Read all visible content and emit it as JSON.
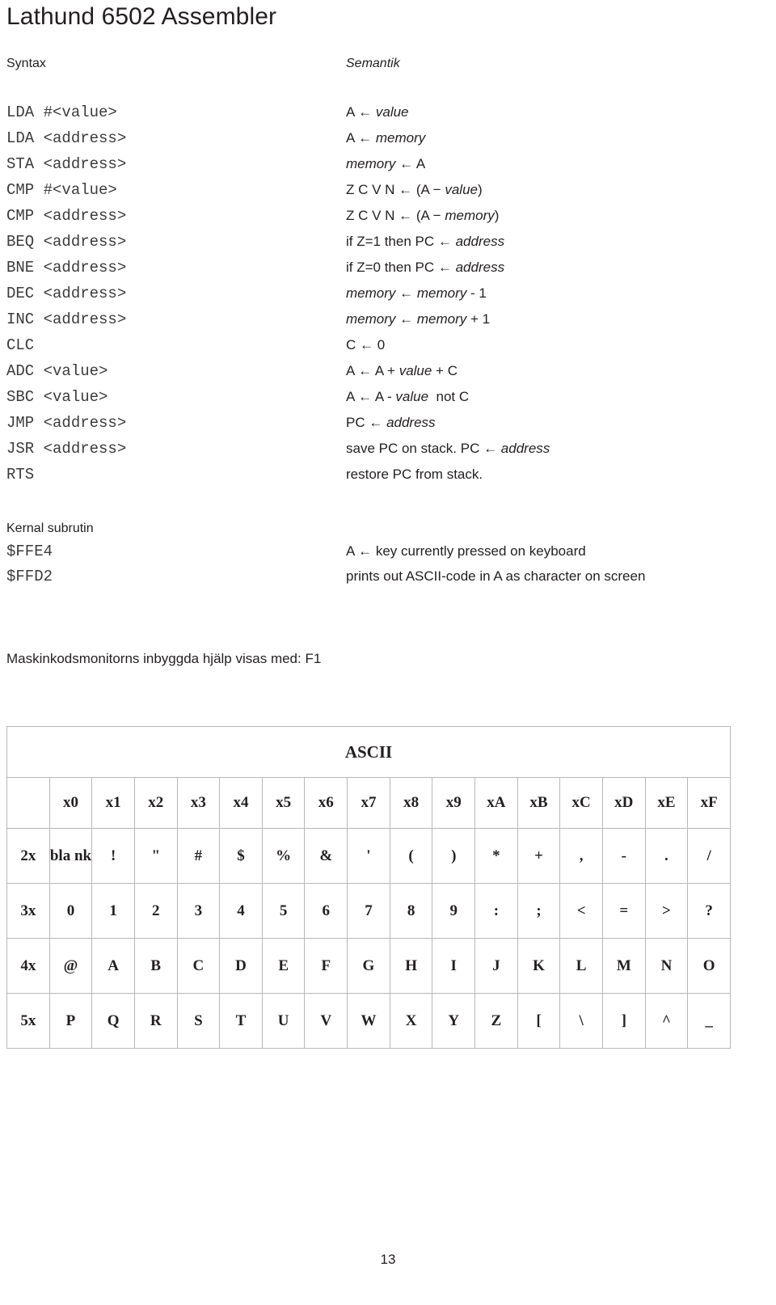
{
  "document": {
    "title": "Lathund 6502 Assembler",
    "page_number": "13"
  },
  "columns": {
    "syntax_header": "Syntax",
    "semantik_header": "Semantik"
  },
  "instructions": [
    {
      "syntax": "LDA #<value>",
      "semantic": "A ← value"
    },
    {
      "syntax": "LDA <address>",
      "semantic": "A ← memory"
    },
    {
      "syntax": "STA <address>",
      "semantic": "memory ← A"
    },
    {
      "syntax": "CMP #<value>",
      "semantic": "Z C V N ← (A − value)"
    },
    {
      "syntax": "CMP <address>",
      "semantic": "Z C V N ← (A − memory)"
    },
    {
      "syntax": "BEQ <address>",
      "semantic": "if Z=1 then PC ← address"
    },
    {
      "syntax": "BNE <address>",
      "semantic": "if Z=0 then PC ← address"
    },
    {
      "syntax": "DEC <address>",
      "semantic": "memory ← memory - 1"
    },
    {
      "syntax": "INC <address>",
      "semantic": "memory ← memory + 1"
    },
    {
      "syntax": "CLC",
      "semantic": "C ← 0"
    },
    {
      "syntax": "ADC <value>",
      "semantic": "A ← A + value + C"
    },
    {
      "syntax": "SBC <value>",
      "semantic": "A ← A - value  not C"
    },
    {
      "syntax": "JMP <address>",
      "semantic": "PC ← address"
    },
    {
      "syntax": "JSR <address>",
      "semantic": "save PC on stack. PC ← address"
    },
    {
      "syntax": "RTS",
      "semantic": "restore PC from stack."
    }
  ],
  "kernal": {
    "title": "Kernal subrutin",
    "rows": [
      {
        "address": "$FFE4",
        "description": "A ← key currently pressed on keyboard"
      },
      {
        "address": "$FFD2",
        "description": "prints out ASCII-code in A as character on screen"
      }
    ]
  },
  "note": "Maskinkodsmonitorns inbyggda hjälp visas med: F1",
  "ascii_table": {
    "caption": "ASCII",
    "columns": [
      "x0",
      "x1",
      "x2",
      "x3",
      "x4",
      "x5",
      "x6",
      "x7",
      "x8",
      "x9",
      "xA",
      "xB",
      "xC",
      "xD",
      "xE",
      "xF"
    ],
    "rows": [
      {
        "label": "2x",
        "cells": [
          "bla nk",
          "!",
          "\"",
          "#",
          "$",
          "%",
          "&",
          "'",
          "(",
          ")",
          "*",
          "+",
          ",",
          "-",
          ".",
          "/"
        ]
      },
      {
        "label": "3x",
        "cells": [
          "0",
          "1",
          "2",
          "3",
          "4",
          "5",
          "6",
          "7",
          "8",
          "9",
          ":",
          ";",
          "<",
          "=",
          ">",
          "?"
        ]
      },
      {
        "label": "4x",
        "cells": [
          "@",
          "A",
          "B",
          "C",
          "D",
          "E",
          "F",
          "G",
          "H",
          "I",
          "J",
          "K",
          "L",
          "M",
          "N",
          "O"
        ]
      },
      {
        "label": "5x",
        "cells": [
          "P",
          "Q",
          "R",
          "S",
          "T",
          "U",
          "V",
          "W",
          "X",
          "Y",
          "Z",
          "[",
          "\\",
          "]",
          "^",
          "_"
        ]
      }
    ]
  }
}
